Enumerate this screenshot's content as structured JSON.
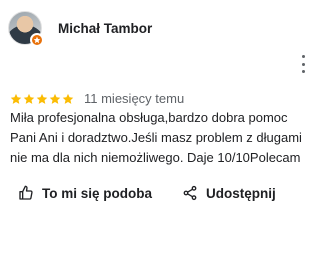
{
  "review": {
    "author_name": "Michał Tambor",
    "rating": 5,
    "rating_max": 5,
    "time_ago": "11 miesięcy temu",
    "text": "Miła profesjonalna obsługa,bardzo dobra pomoc Pani Ani i doradztwo.Jeśli masz problem z długami nie ma dla nich niemożliwego. Daje 10/10Polecam"
  },
  "actions": {
    "like_label": "To mi się podoba",
    "share_label": "Udostępnij"
  },
  "icons": {
    "avatar_badge": "local-guide-star-icon",
    "menu": "more-vert-icon",
    "like": "thumb-up-icon",
    "share": "share-icon"
  },
  "colors": {
    "star": "#fbbc04",
    "badge": "#e8710a",
    "text": "#202124",
    "muted": "#5f6368"
  }
}
